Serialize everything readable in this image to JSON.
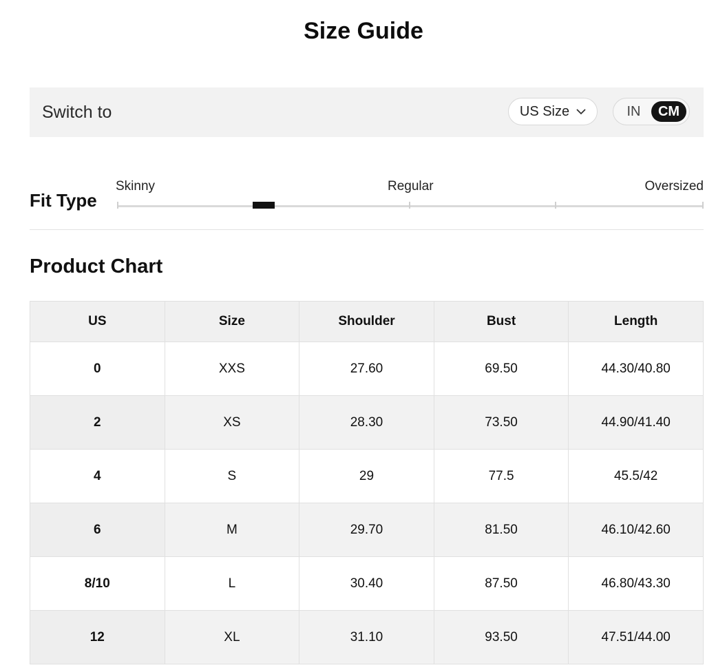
{
  "title": "Size Guide",
  "switch": {
    "label": "Switch to",
    "size_system": "US Size",
    "units": [
      "IN",
      "CM"
    ],
    "active_unit": "CM"
  },
  "fit": {
    "title": "Fit Type",
    "labels": [
      "Skinny",
      "Regular",
      "Oversized"
    ],
    "value": 0.25
  },
  "chart": {
    "title": "Product Chart",
    "columns": [
      "US",
      "Size",
      "Shoulder",
      "Bust",
      "Length"
    ],
    "rows": [
      [
        "0",
        "XXS",
        "27.60",
        "69.50",
        "44.30/40.80"
      ],
      [
        "2",
        "XS",
        "28.30",
        "73.50",
        "44.90/41.40"
      ],
      [
        "4",
        "S",
        "29",
        "77.5",
        "45.5/42"
      ],
      [
        "6",
        "M",
        "29.70",
        "81.50",
        "46.10/42.60"
      ],
      [
        "8/10",
        "L",
        "30.40",
        "87.50",
        "46.80/43.30"
      ],
      [
        "12",
        "XL",
        "31.10",
        "93.50",
        "47.51/44.00"
      ]
    ]
  },
  "colors": {
    "accent": "#151515",
    "panel": "#f2f2f2"
  }
}
